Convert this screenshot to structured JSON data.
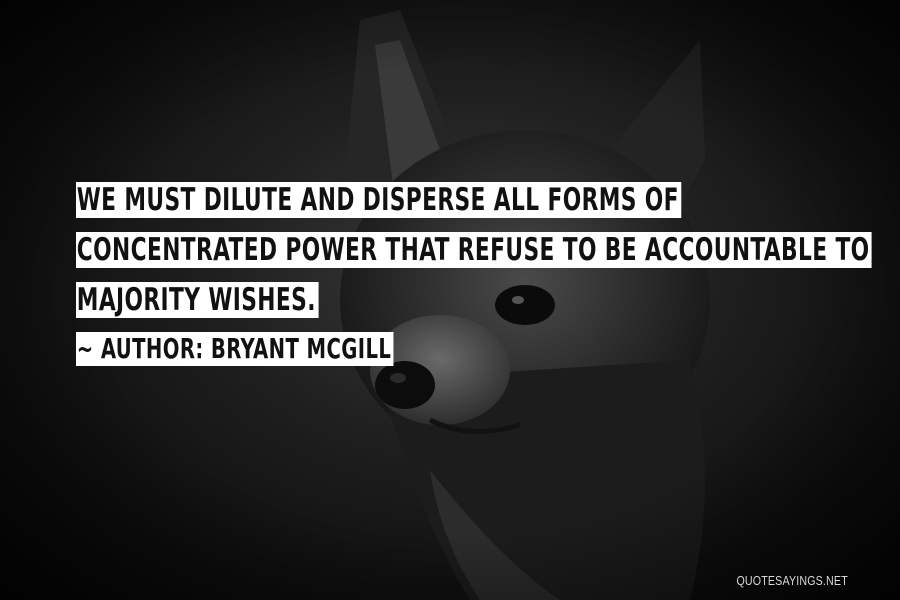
{
  "quote": {
    "lines": [
      "WE MUST DILUTE AND DISPERSE ALL FORMS OF",
      "CONCENTRATED POWER THAT REFUSE TO BE ACCOUNTABLE TO",
      "MAJORITY WISHES."
    ],
    "author_line": "~ AUTHOR: BRYANT MCGILL"
  },
  "watermark": "QUOTESAYINGS.NET",
  "background": {
    "description_icon": "dog-photo",
    "base_color": "#0d0d0d"
  }
}
